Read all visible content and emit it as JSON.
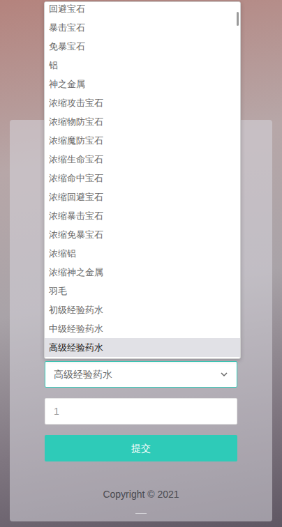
{
  "dropdown": {
    "options": [
      {
        "label": "回避宝石",
        "selected": false
      },
      {
        "label": "暴击宝石",
        "selected": false
      },
      {
        "label": "免暴宝石",
        "selected": false
      },
      {
        "label": "铝",
        "selected": false
      },
      {
        "label": "神之金属",
        "selected": false
      },
      {
        "label": "浓缩攻击宝石",
        "selected": false
      },
      {
        "label": "浓缩物防宝石",
        "selected": false
      },
      {
        "label": "浓缩魔防宝石",
        "selected": false
      },
      {
        "label": "浓缩生命宝石",
        "selected": false
      },
      {
        "label": "浓缩命中宝石",
        "selected": false
      },
      {
        "label": "浓缩回避宝石",
        "selected": false
      },
      {
        "label": "浓缩暴击宝石",
        "selected": false
      },
      {
        "label": "浓缩免暴宝石",
        "selected": false
      },
      {
        "label": "浓缩铝",
        "selected": false
      },
      {
        "label": "浓缩神之金属",
        "selected": false
      },
      {
        "label": "羽毛",
        "selected": false
      },
      {
        "label": "初级经验药水",
        "selected": false
      },
      {
        "label": "中级经验药水",
        "selected": false
      },
      {
        "label": "高级经验药水",
        "selected": true
      }
    ]
  },
  "form": {
    "select_value": "高级经验药水",
    "quantity": "1",
    "submit": "提交"
  },
  "footer": {
    "copyright": "Copyright © 2021"
  }
}
